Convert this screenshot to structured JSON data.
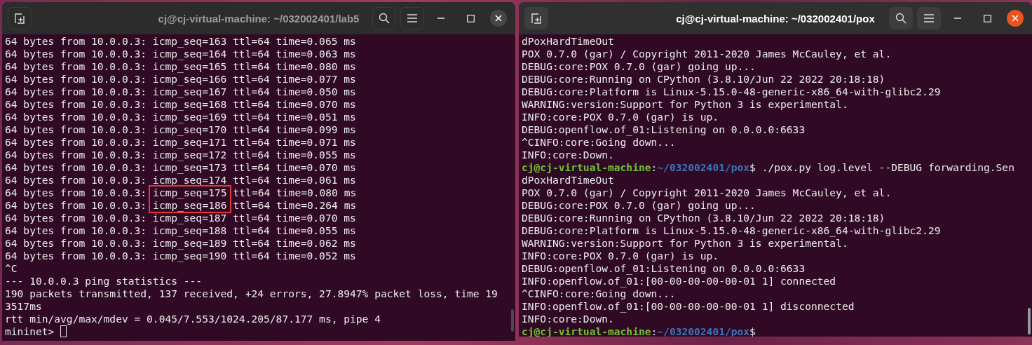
{
  "windows": [
    {
      "title": "cj@cj-virtual-machine: ~/032002401/lab5",
      "active": false,
      "lines": [
        {
          "kind": "output",
          "text": "64 bytes from 10.0.0.3: icmp_seq=163 ttl=64 time=0.065 ms"
        },
        {
          "kind": "output",
          "text": "64 bytes from 10.0.0.3: icmp_seq=164 ttl=64 time=0.063 ms"
        },
        {
          "kind": "output",
          "text": "64 bytes from 10.0.0.3: icmp_seq=165 ttl=64 time=0.080 ms"
        },
        {
          "kind": "output",
          "text": "64 bytes from 10.0.0.3: icmp_seq=166 ttl=64 time=0.077 ms"
        },
        {
          "kind": "output",
          "text": "64 bytes from 10.0.0.3: icmp_seq=167 ttl=64 time=0.050 ms"
        },
        {
          "kind": "output",
          "text": "64 bytes from 10.0.0.3: icmp_seq=168 ttl=64 time=0.070 ms"
        },
        {
          "kind": "output",
          "text": "64 bytes from 10.0.0.3: icmp_seq=169 ttl=64 time=0.051 ms"
        },
        {
          "kind": "output",
          "text": "64 bytes from 10.0.0.3: icmp_seq=170 ttl=64 time=0.099 ms"
        },
        {
          "kind": "output",
          "text": "64 bytes from 10.0.0.3: icmp_seq=171 ttl=64 time=0.071 ms"
        },
        {
          "kind": "output",
          "text": "64 bytes from 10.0.0.3: icmp_seq=172 ttl=64 time=0.055 ms"
        },
        {
          "kind": "output",
          "text": "64 bytes from 10.0.0.3: icmp_seq=173 ttl=64 time=0.070 ms"
        },
        {
          "kind": "output",
          "text": "64 bytes from 10.0.0.3: icmp_seq=174 ttl=64 time=0.061 ms"
        },
        {
          "kind": "marked",
          "before": "64 bytes from 10.0.0.3:",
          "marked": "icmp_seq=175",
          "after": "ttl=64 time=0.080 ms"
        },
        {
          "kind": "marked",
          "before": "64 bytes from 10.0.0.3:",
          "marked": "icmp_seq=186",
          "after": "ttl=64 time=0.264 ms"
        },
        {
          "kind": "output",
          "text": "64 bytes from 10.0.0.3: icmp_seq=187 ttl=64 time=0.070 ms"
        },
        {
          "kind": "output",
          "text": "64 bytes from 10.0.0.3: icmp_seq=188 ttl=64 time=0.055 ms"
        },
        {
          "kind": "output",
          "text": "64 bytes from 10.0.0.3: icmp_seq=189 ttl=64 time=0.062 ms"
        },
        {
          "kind": "output",
          "text": "64 bytes from 10.0.0.3: icmp_seq=190 ttl=64 time=0.052 ms"
        },
        {
          "kind": "output",
          "text": "^C"
        },
        {
          "kind": "output",
          "text": "--- 10.0.0.3 ping statistics ---"
        },
        {
          "kind": "output",
          "text": "190 packets transmitted, 137 received, +24 errors, 27.8947% packet loss, time 19"
        },
        {
          "kind": "output",
          "text": "3517ms"
        },
        {
          "kind": "output",
          "text": "rtt min/avg/max/mdev = 0.045/7.553/1024.205/87.177 ms, pipe 4"
        },
        {
          "kind": "input",
          "prompt": "mininet>"
        }
      ]
    },
    {
      "title": "cj@cj-virtual-machine: ~/032002401/pox",
      "active": true,
      "lines": [
        {
          "kind": "output",
          "text": "dPoxHardTimeOut"
        },
        {
          "kind": "output",
          "text": "POX 0.7.0 (gar) / Copyright 2011-2020 James McCauley, et al."
        },
        {
          "kind": "output",
          "text": "DEBUG:core:POX 0.7.0 (gar) going up..."
        },
        {
          "kind": "output",
          "text": "DEBUG:core:Running on CPython (3.8.10/Jun 22 2022 20:18:18)"
        },
        {
          "kind": "output",
          "text": "DEBUG:core:Platform is Linux-5.15.0-48-generic-x86_64-with-glibc2.29"
        },
        {
          "kind": "output",
          "text": "WARNING:version:Support for Python 3 is experimental."
        },
        {
          "kind": "output",
          "text": "INFO:core:POX 0.7.0 (gar) is up."
        },
        {
          "kind": "output",
          "text": "DEBUG:openflow.of_01:Listening on 0.0.0.0:6633"
        },
        {
          "kind": "output",
          "text": "^CINFO:core:Going down..."
        },
        {
          "kind": "output",
          "text": "INFO:core:Down."
        },
        {
          "kind": "prompt",
          "user": "cj@cj-virtual-machine",
          "separator": ":",
          "path": "~/032002401/pox",
          "command": "$ ./pox.py log.level --DEBUG forwarding.Sen"
        },
        {
          "kind": "output",
          "text": "dPoxHardTimeOut"
        },
        {
          "kind": "output",
          "text": "POX 0.7.0 (gar) / Copyright 2011-2020 James McCauley, et al."
        },
        {
          "kind": "output",
          "text": "DEBUG:core:POX 0.7.0 (gar) going up..."
        },
        {
          "kind": "output",
          "text": "DEBUG:core:Running on CPython (3.8.10/Jun 22 2022 20:18:18)"
        },
        {
          "kind": "output",
          "text": "DEBUG:core:Platform is Linux-5.15.0-48-generic-x86_64-with-glibc2.29"
        },
        {
          "kind": "output",
          "text": "WARNING:version:Support for Python 3 is experimental."
        },
        {
          "kind": "output",
          "text": "INFO:core:POX 0.7.0 (gar) is up."
        },
        {
          "kind": "output",
          "text": "DEBUG:openflow.of_01:Listening on 0.0.0.0:6633"
        },
        {
          "kind": "output",
          "text": "INFO:openflow.of_01:[00-00-00-00-00-01 1] connected"
        },
        {
          "kind": "output",
          "text": "^CINFO:core:Going down..."
        },
        {
          "kind": "output",
          "text": "INFO:openflow.of_01:[00-00-00-00-00-01 1] disconnected"
        },
        {
          "kind": "output",
          "text": "INFO:core:Down."
        },
        {
          "kind": "prompt",
          "user": "cj@cj-virtual-machine",
          "separator": ":",
          "path": "~/032002401/pox",
          "command": "$"
        }
      ]
    }
  ]
}
